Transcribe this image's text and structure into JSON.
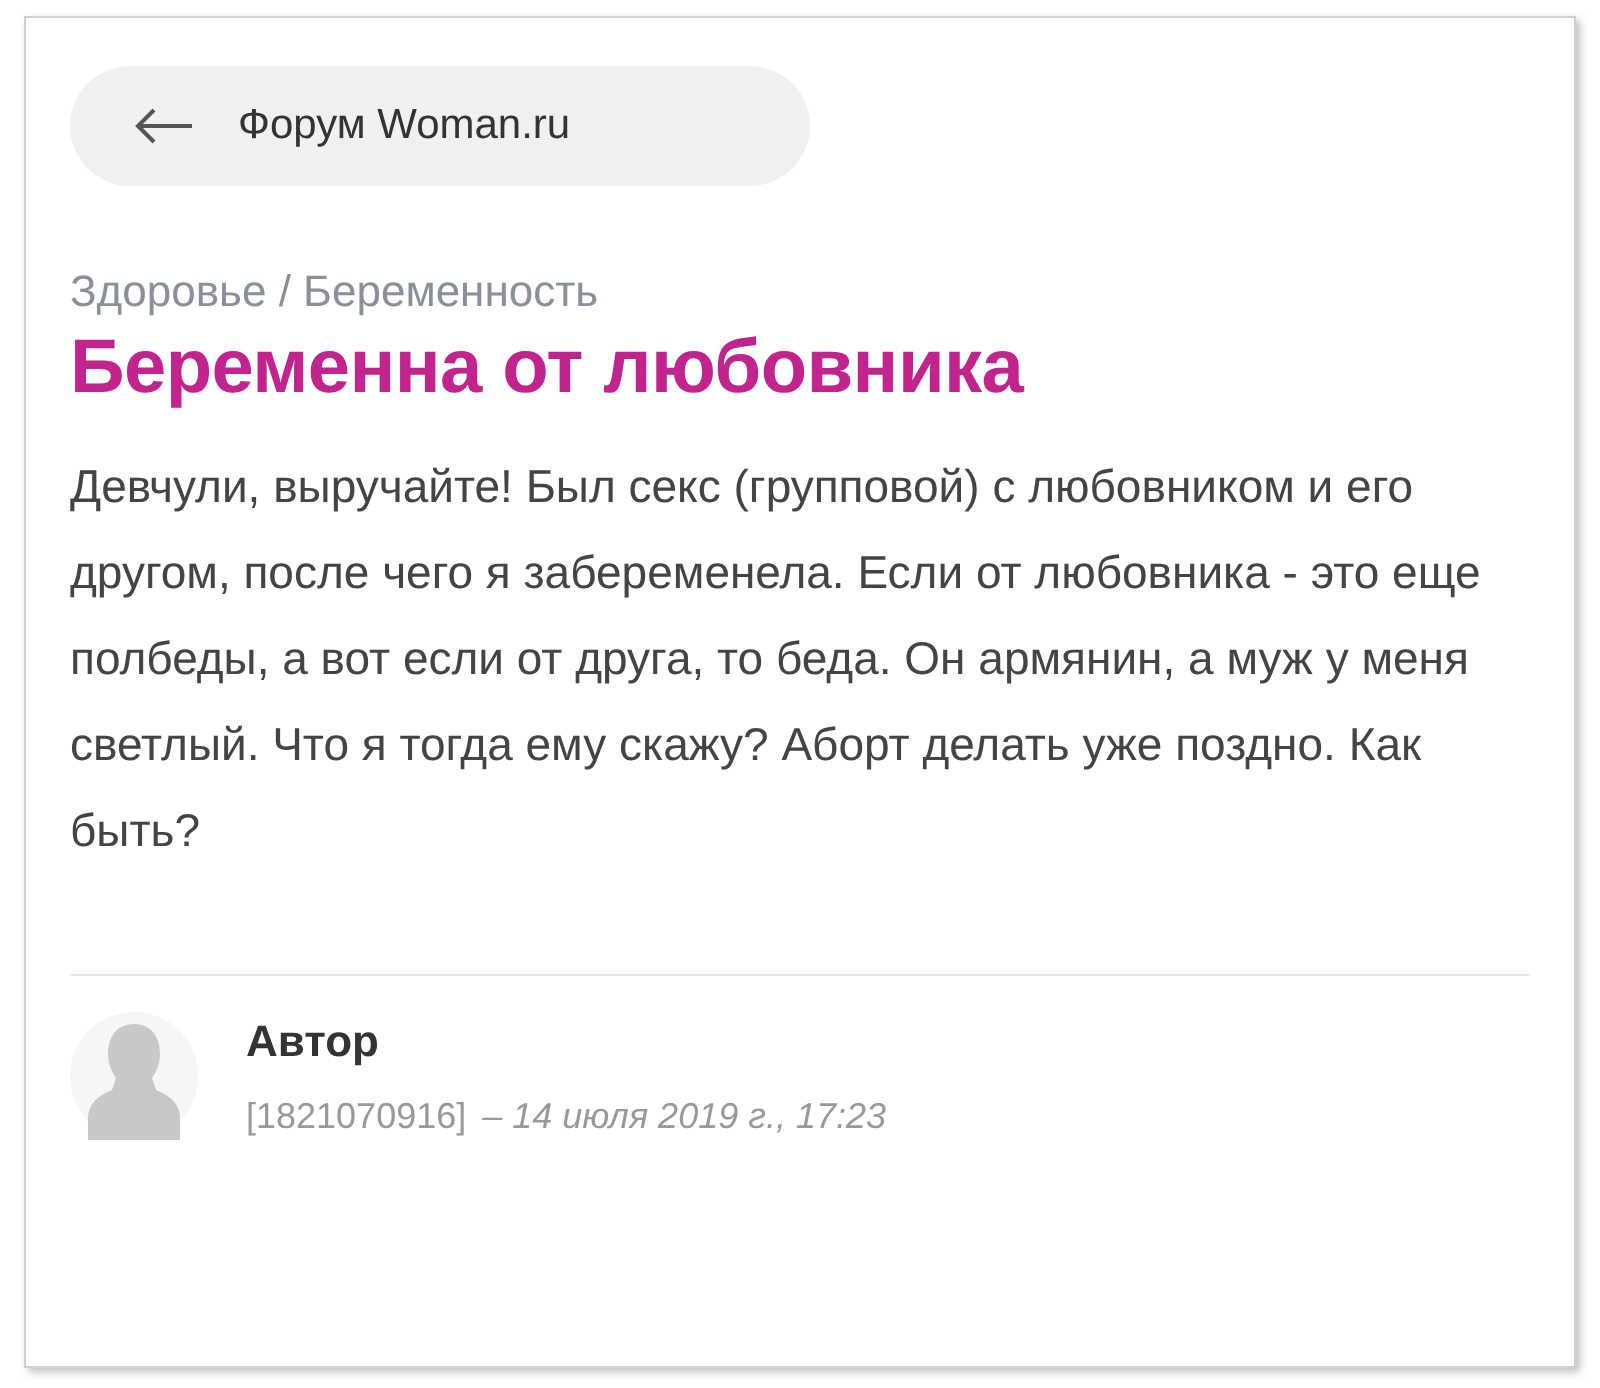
{
  "back_button": {
    "label": "Форум Woman.ru"
  },
  "breadcrumb": "Здоровье / Беременность",
  "title": "Беременна от любовника",
  "body": "Девчули, выручайте! Был секс (групповой) с любовником и его другом, после чего я забеременела. Если от любовника - это еще полбеды, а вот если от друга, то беда. Он армянин, а муж у меня светлый. Что я тогда ему скажу? Аборт делать уже поздно. Как быть?",
  "author": {
    "name": "Автор",
    "id": "[1821070916]",
    "date": "– 14 июля 2019 г., 17:23"
  }
}
